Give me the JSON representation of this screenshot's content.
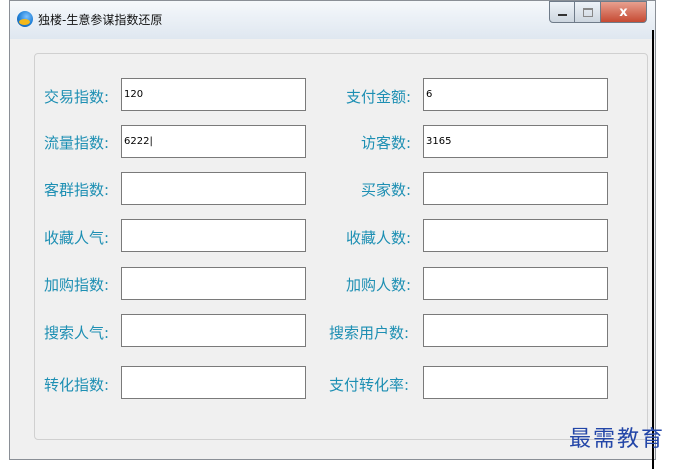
{
  "window": {
    "title": "独楼-生意参谋指数还原",
    "controls": {
      "close_symbol": "x"
    }
  },
  "fields": {
    "trade_index": {
      "label": "交易指数:",
      "value": "120"
    },
    "pay_amount": {
      "label": "支付金额:",
      "value": "6"
    },
    "traffic_index": {
      "label": "流量指数:",
      "value": "6222|"
    },
    "visitors": {
      "label": "访客数:",
      "value": "3165"
    },
    "customer_index": {
      "label": "客群指数:",
      "value": ""
    },
    "buyers": {
      "label": "买家数:",
      "value": ""
    },
    "favorite_popularity": {
      "label": "收藏人气:",
      "value": ""
    },
    "favorite_count": {
      "label": "收藏人数:",
      "value": ""
    },
    "cart_index": {
      "label": "加购指数:",
      "value": ""
    },
    "cart_count": {
      "label": "加购人数:",
      "value": ""
    },
    "search_popularity": {
      "label": "搜索人气:",
      "value": ""
    },
    "search_users": {
      "label": "搜索用户数:",
      "value": ""
    },
    "conversion_index": {
      "label": "转化指数:",
      "value": ""
    },
    "pay_conversion_rate": {
      "label": "支付转化率:",
      "value": ""
    }
  },
  "watermark": {
    "text": "最需教育"
  },
  "colors": {
    "label": "#1d8fb3",
    "close_button": "#c64a33"
  }
}
